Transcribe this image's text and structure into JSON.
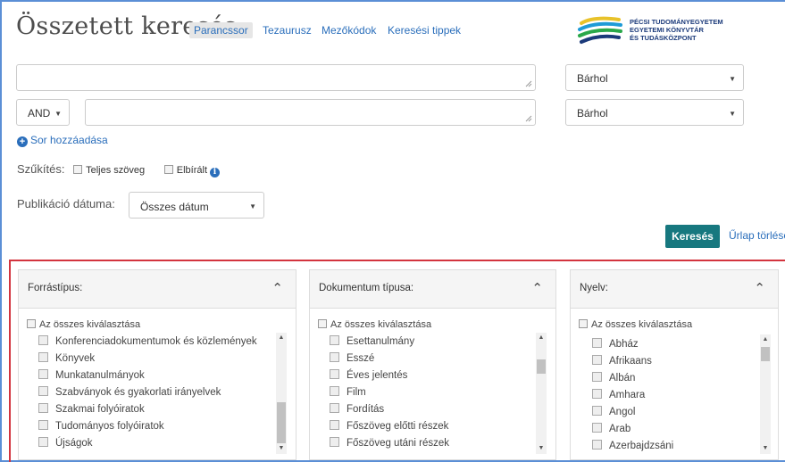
{
  "header": {
    "title": "Összetett keresés",
    "tabs": [
      "Parancssor",
      "Tezaurusz",
      "Mezőkódok",
      "Keresési tippek"
    ],
    "logo_lines": [
      "PÉCSI TUDOMÁNYEGYETEM",
      "EGYETEMI KÖNYVTÁR",
      "ÉS TUDÁSKÖZPONT"
    ]
  },
  "search": {
    "row1_field": "Bárhol",
    "row2_operator": "AND",
    "row2_field": "Bárhol",
    "add_row": "Sor hozzáadása"
  },
  "filters": {
    "narrow_label": "Szűkítés:",
    "fulltext": "Teljes szöveg",
    "peer_reviewed": "Elbírált",
    "pubdate_label": "Publikáció dátuma:",
    "pubdate_value": "Összes dátum"
  },
  "actions": {
    "search": "Keresés",
    "reset": "Űrlap törlése"
  },
  "facets": {
    "source": {
      "title": "Forrástípus:",
      "select_all": "Az összes kiválasztása",
      "items": [
        "Konferenciadokumentumok és közlemények",
        "Könyvek",
        "Munkatanulmányok",
        "Szabványok és gyakorlati irányelvek",
        "Szakmai folyóiratok",
        "Tudományos folyóiratok",
        "Újságok"
      ]
    },
    "doctype": {
      "title": "Dokumentum típusa:",
      "select_all": "Az összes kiválasztása",
      "items": [
        "Esettanulmány",
        "Esszé",
        "Éves jelentés",
        "Film",
        "Fordítás",
        "Főszöveg előtti részek",
        "Főszöveg utáni részek"
      ]
    },
    "language": {
      "title": "Nyelv:",
      "select_all": "Az összes kiválasztása",
      "items": [
        "Abház",
        "Afrikaans",
        "Albán",
        "Amhara",
        "Angol",
        "Arab",
        "Azerbajdzsáni"
      ]
    }
  },
  "colors": {
    "link": "#2a6ebb",
    "button": "#17787f",
    "frame": "#5b8fd6",
    "facet_border": "#d3343e"
  }
}
